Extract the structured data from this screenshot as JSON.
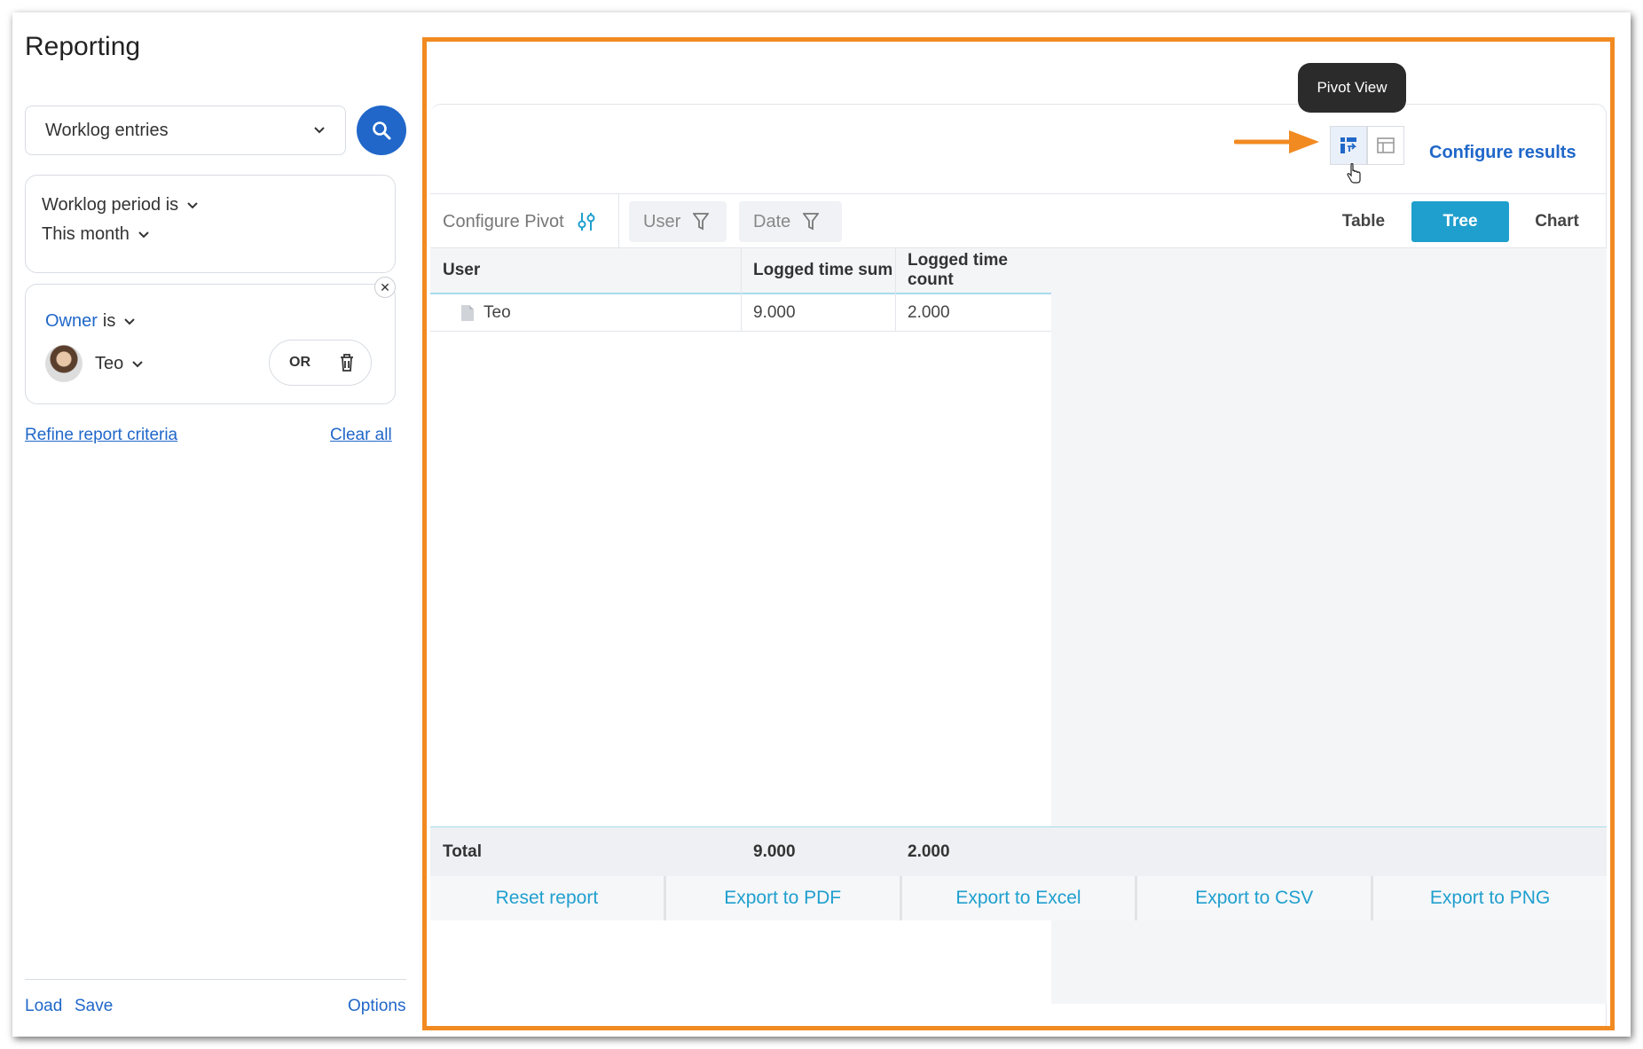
{
  "sidebar": {
    "title": "Reporting",
    "datasource": "Worklog entries",
    "filter_period": {
      "label": "Worklog period is",
      "value": "This month"
    },
    "filter_owner": {
      "field": "Owner",
      "operator": "is",
      "user": "Teo",
      "logic": "OR"
    },
    "refine_link": "Refine report criteria",
    "clear_link": "Clear all",
    "footer": {
      "load": "Load",
      "save": "Save",
      "options": "Options"
    }
  },
  "main": {
    "tooltip": "Pivot View",
    "configure_results": "Configure results",
    "configure_pivot": "Configure Pivot",
    "chips": [
      "User",
      "Date"
    ],
    "modes": [
      "Table",
      "Tree",
      "Chart"
    ],
    "active_mode": "Tree",
    "columns": [
      "User",
      "Logged time sum",
      "Logged time count"
    ],
    "rows": [
      {
        "user": "Teo",
        "sum": "9.000",
        "count": "2.000"
      }
    ],
    "total": {
      "label": "Total",
      "sum": "9.000",
      "count": "2.000"
    },
    "exports": [
      "Reset report",
      "Export to PDF",
      "Export to Excel",
      "Export to CSV",
      "Export to PNG"
    ]
  },
  "colors": {
    "accent_blue": "#2067c9",
    "teal": "#1f9fce",
    "highlight_orange": "#f28a22"
  },
  "icons": [
    "search-icon",
    "chevron-down-icon",
    "trash-icon",
    "close-icon",
    "pivot-view-icon",
    "table-view-icon",
    "sliders-icon",
    "filter-icon",
    "file-icon",
    "pointer-cursor-icon"
  ]
}
